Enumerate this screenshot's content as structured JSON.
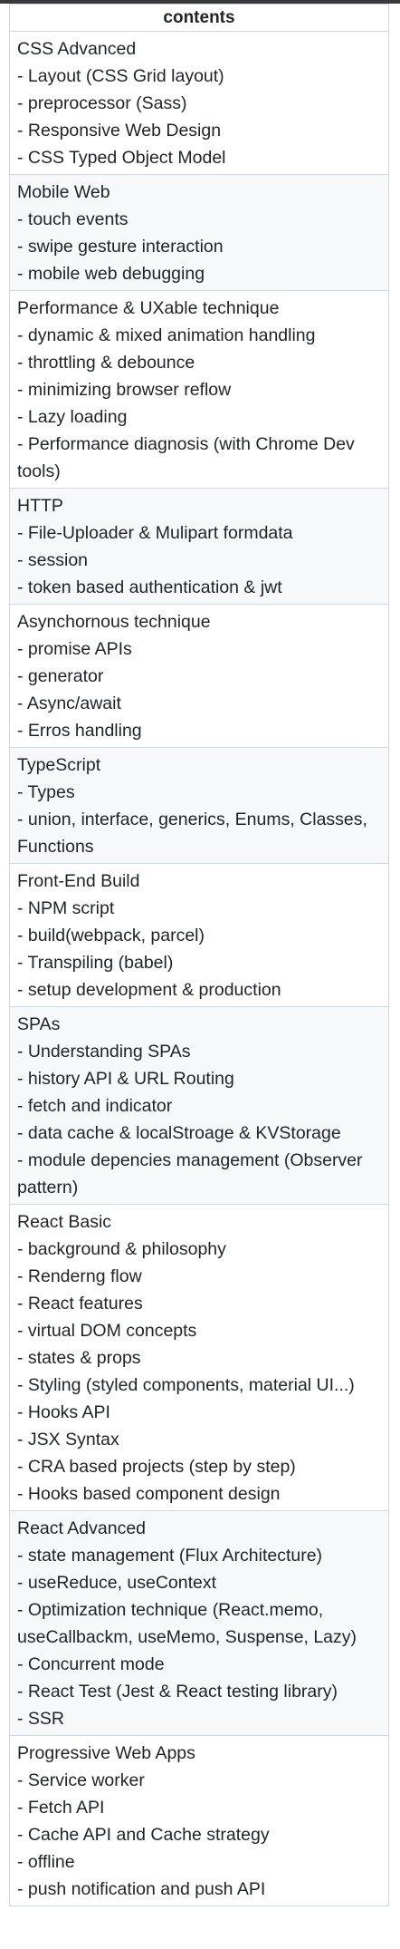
{
  "table": {
    "header": "contents",
    "rows": [
      {
        "title": "CSS Advanced",
        "items": [
          "- Layout (CSS Grid layout)",
          "- preprocessor (Sass)",
          "- Responsive Web Design",
          "- CSS Typed Object Model"
        ]
      },
      {
        "title": "Mobile Web",
        "items": [
          "- touch events",
          "- swipe gesture interaction",
          "- mobile web debugging"
        ]
      },
      {
        "title": "Performance & UXable technique",
        "items": [
          "- dynamic & mixed animation handling",
          "- throttling & debounce",
          "- minimizing browser reflow",
          "- Lazy loading",
          "- Performance diagnosis (with Chrome Dev tools)"
        ]
      },
      {
        "title": "HTTP",
        "items": [
          "- File-Uploader & Mulipart formdata",
          "- session",
          "- token based authentication & jwt"
        ]
      },
      {
        "title": "Asynchornous technique",
        "items": [
          "- promise APIs",
          "- generator",
          "- Async/await",
          "- Erros handling"
        ]
      },
      {
        "title": "TypeScript",
        "items": [
          "- Types",
          "- union, interface, generics, Enums, Classes, Functions"
        ]
      },
      {
        "title": "Front-End Build",
        "items": [
          "- NPM script",
          "- build(webpack, parcel)",
          "- Transpiling (babel)",
          "- setup development & production"
        ]
      },
      {
        "title": "SPAs",
        "items": [
          "- Understanding SPAs",
          "- history API & URL Routing",
          "- fetch and indicator",
          "- data cache & localStroage & KVStorage",
          "- module depencies management (Observer pattern)"
        ]
      },
      {
        "title": "React Basic",
        "items": [
          "- background & philosophy",
          "- Renderng flow",
          "- React features",
          "- virtual DOM concepts",
          "- states & props",
          "- Styling (styled components, material UI...)",
          "- Hooks API",
          "- JSX Syntax",
          "- CRA based projects (step by step)",
          "- Hooks based component design"
        ]
      },
      {
        "title": "React Advanced",
        "items": [
          "- state management (Flux Architecture)",
          "- useReduce, useContext",
          "- Optimization technique (React.memo, useCallbackm, useMemo, Suspense, Lazy)",
          "- Concurrent mode",
          "- React Test (Jest & React testing library)",
          "- SSR"
        ]
      },
      {
        "title": "Progressive Web Apps",
        "items": [
          "- Service worker",
          "- Fetch API",
          "- Cache API and Cache strategy",
          "- offline",
          "- push notification and push API"
        ]
      }
    ]
  }
}
